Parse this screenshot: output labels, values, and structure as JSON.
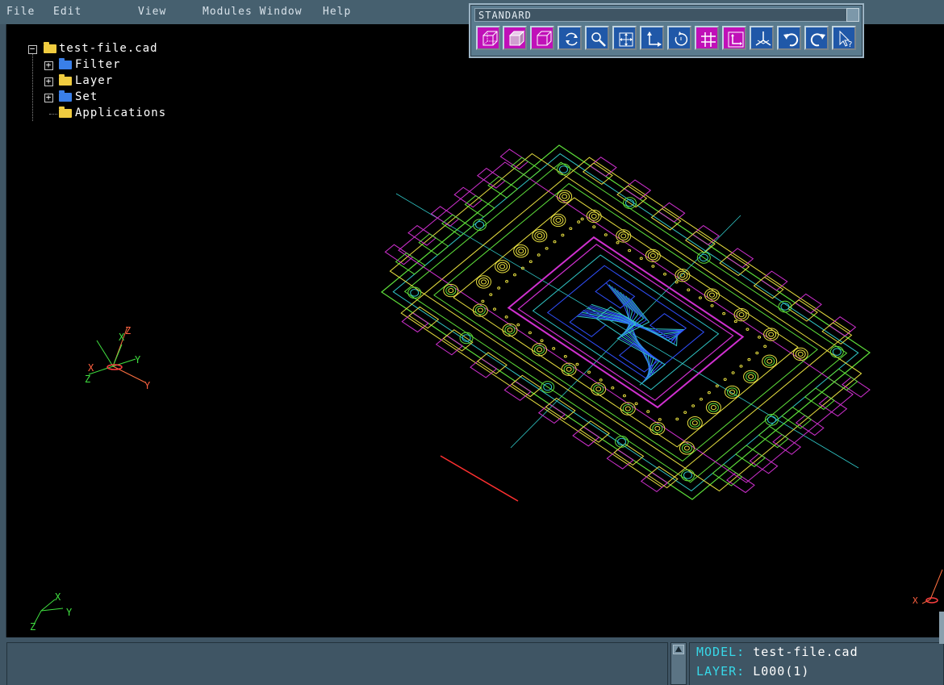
{
  "menu": {
    "file": "File",
    "edit": "Edit",
    "view": "View",
    "modules_window": "Modules Window",
    "help": "Help"
  },
  "tree": {
    "root": "test-file.cad",
    "items": [
      {
        "label": "Filter",
        "folder_color": "#3a7fe8",
        "expandable": true
      },
      {
        "label": "Layer",
        "folder_color": "#f0cc40",
        "expandable": true
      },
      {
        "label": "Set",
        "folder_color": "#3a7fe8",
        "expandable": true
      },
      {
        "label": "Applications",
        "folder_color": "#f0cc40",
        "expandable": false
      }
    ]
  },
  "toolbar": {
    "title": "STANDARD",
    "buttons": [
      {
        "name": "wireframe-box-icon",
        "color": "magenta"
      },
      {
        "name": "shaded-box-icon",
        "color": "magenta"
      },
      {
        "name": "hidden-line-box-icon",
        "color": "magenta"
      },
      {
        "name": "rotate-icon",
        "color": "blue"
      },
      {
        "name": "zoom-icon",
        "color": "blue"
      },
      {
        "name": "pan-icon",
        "color": "blue"
      },
      {
        "name": "axis-icon",
        "color": "blue"
      },
      {
        "name": "rotate-dynamic-icon",
        "color": "blue"
      },
      {
        "name": "grid-icon",
        "color": "magenta"
      },
      {
        "name": "coordinate-frame-icon",
        "color": "magenta"
      },
      {
        "name": "isometric-view-icon",
        "color": "blue"
      },
      {
        "name": "undo-icon",
        "color": "blue"
      },
      {
        "name": "redo-icon",
        "color": "blue"
      },
      {
        "name": "select-help-icon",
        "color": "blue"
      }
    ]
  },
  "axes": {
    "x": "X",
    "y": "Y",
    "z": "Z"
  },
  "status": {
    "model_label": "MODEL:",
    "model_value": "test-file.cad",
    "layer_label": "LAYER:",
    "layer_value": "L000(1)"
  },
  "colors": {
    "background": "#3f5564",
    "viewport": "#000000",
    "cad_green": "#5ee03a",
    "cad_yellow": "#e8e040",
    "cad_cyan": "#30c8c8",
    "cad_magenta": "#d030d0",
    "cad_blue": "#3050ff",
    "axis_red": "#ff3030"
  }
}
